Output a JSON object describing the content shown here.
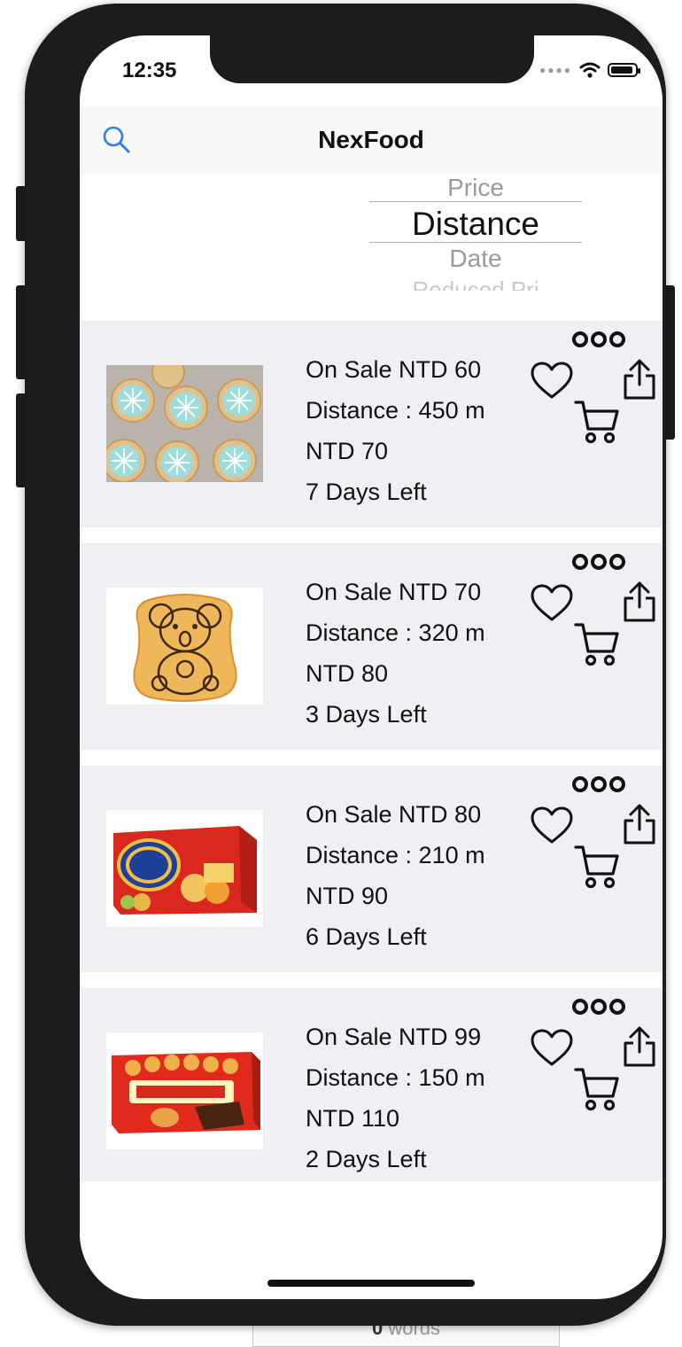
{
  "status_bar": {
    "time": "12:35"
  },
  "nav": {
    "title": "NexFood",
    "search_icon": "search-icon"
  },
  "sort_picker": {
    "options": [
      "Price",
      "Distance",
      "Date",
      "Reduced Pri"
    ],
    "selected": "Distance"
  },
  "items": [
    {
      "sale": "On Sale NTD 60",
      "distance": "Distance : 450 m",
      "price": "NTD 70",
      "days_left": "7 Days Left",
      "image": "snowflake-cookies"
    },
    {
      "sale": "On Sale NTD 70",
      "distance": "Distance : 320 m",
      "price": "NTD 80",
      "days_left": "3 Days Left",
      "image": "koala-biscuit"
    },
    {
      "sale": "On Sale NTD 80",
      "distance": "Distance : 210 m",
      "price": "NTD 90",
      "days_left": "6 Days Left",
      "image": "ritz-crackers-box"
    },
    {
      "sale": "On Sale NTD 99",
      "distance": "Distance : 150 m",
      "price": "NTD 110",
      "days_left": "2 Days Left",
      "image": "choco-puff-box"
    }
  ],
  "background": {
    "word_count": "0",
    "word_label": "words"
  },
  "colors": {
    "accent": "#2f7cf6",
    "row_bg": "#efeff4",
    "nav_bg": "#f8f8f8"
  }
}
